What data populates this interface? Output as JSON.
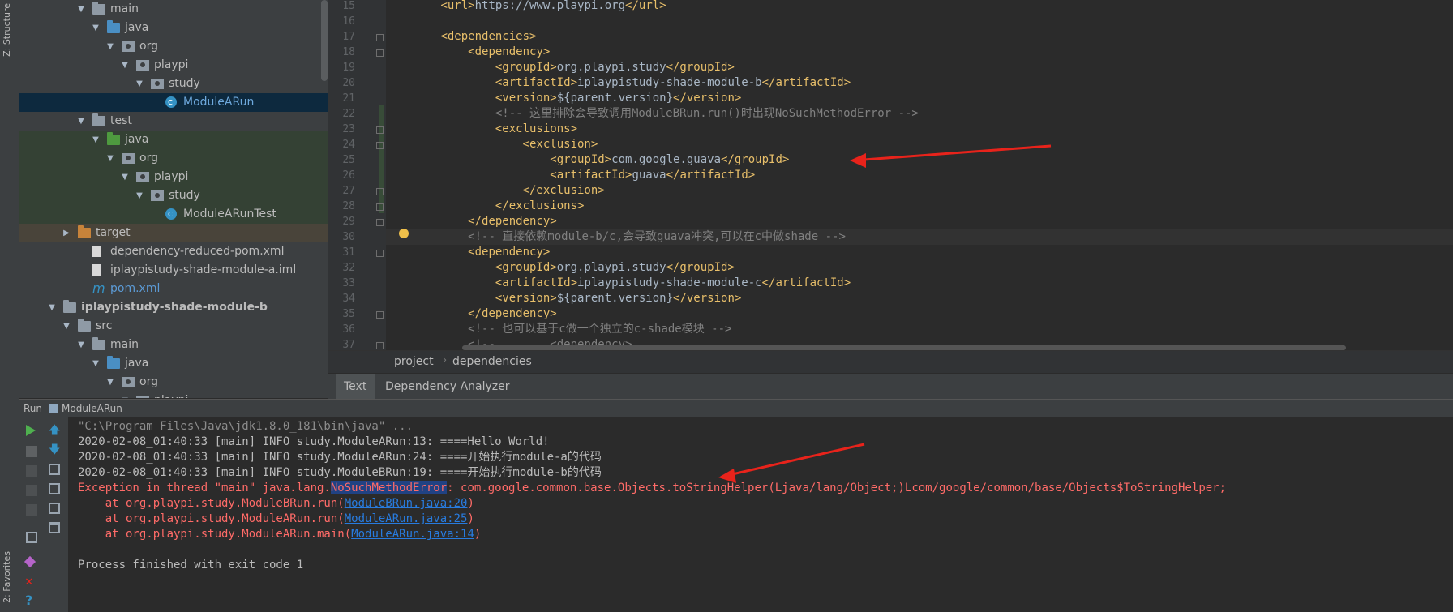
{
  "side_strip": {
    "top_label": "Z: Structure",
    "bottom_label": "2: Favorites"
  },
  "tree": [
    {
      "label": "main",
      "type": "folder",
      "depth": 3,
      "open": true
    },
    {
      "label": "java",
      "type": "folder-src",
      "depth": 4,
      "open": true
    },
    {
      "label": "org",
      "type": "pkg",
      "depth": 5,
      "open": true
    },
    {
      "label": "playpi",
      "type": "pkg",
      "depth": 6,
      "open": true
    },
    {
      "label": "study",
      "type": "pkg",
      "depth": 7,
      "open": true
    },
    {
      "label": "ModuleARun",
      "type": "class",
      "depth": 8,
      "open": null,
      "selected": true
    },
    {
      "label": "test",
      "type": "folder",
      "depth": 3,
      "open": true
    },
    {
      "label": "java",
      "type": "folder-test",
      "depth": 4,
      "open": true,
      "testbg": true
    },
    {
      "label": "org",
      "type": "pkg",
      "depth": 5,
      "open": true,
      "testbg": true
    },
    {
      "label": "playpi",
      "type": "pkg",
      "depth": 6,
      "open": true,
      "testbg": true
    },
    {
      "label": "study",
      "type": "pkg",
      "depth": 7,
      "open": true,
      "testbg": true
    },
    {
      "label": "ModuleARunTest",
      "type": "class",
      "depth": 8,
      "open": null,
      "testbg": true
    },
    {
      "label": "target",
      "type": "folder-orange",
      "depth": 2,
      "open": false,
      "targetbg": true
    },
    {
      "label": "dependency-reduced-pom.xml",
      "type": "file",
      "depth": 3,
      "open": null
    },
    {
      "label": "iplaypistudy-shade-module-a.iml",
      "type": "file",
      "depth": 3,
      "open": null
    },
    {
      "label": "pom.xml",
      "type": "maven",
      "depth": 3,
      "open": null,
      "blue": true
    },
    {
      "label": "iplaypistudy-shade-module-b",
      "type": "folder",
      "depth": 1,
      "open": true,
      "bold": true
    },
    {
      "label": "src",
      "type": "folder",
      "depth": 2,
      "open": true
    },
    {
      "label": "main",
      "type": "folder",
      "depth": 3,
      "open": true
    },
    {
      "label": "java",
      "type": "folder-src",
      "depth": 4,
      "open": true
    },
    {
      "label": "org",
      "type": "pkg",
      "depth": 5,
      "open": true
    },
    {
      "label": "playpi",
      "type": "pkg",
      "depth": 6,
      "open": true
    }
  ],
  "gutter_lines": [
    "15",
    "16",
    "17",
    "18",
    "19",
    "20",
    "21",
    "22",
    "23",
    "24",
    "25",
    "26",
    "27",
    "28",
    "29",
    "30",
    "31",
    "32",
    "33",
    "34",
    "35",
    "36",
    "37"
  ],
  "code_lines": [
    [
      {
        "c": "txt",
        "t": "        "
      },
      {
        "c": "tag",
        "t": "<url>"
      },
      {
        "c": "txt",
        "t": "https://www.playpi.org"
      },
      {
        "c": "tag",
        "t": "</url>"
      }
    ],
    [],
    [
      {
        "c": "txt",
        "t": "        "
      },
      {
        "c": "tag",
        "t": "<dependencies>"
      }
    ],
    [
      {
        "c": "txt",
        "t": "            "
      },
      {
        "c": "tag",
        "t": "<dependency>"
      }
    ],
    [
      {
        "c": "txt",
        "t": "                "
      },
      {
        "c": "tag",
        "t": "<groupId>"
      },
      {
        "c": "txt",
        "t": "org.playpi.study"
      },
      {
        "c": "tag",
        "t": "</groupId>"
      }
    ],
    [
      {
        "c": "txt",
        "t": "                "
      },
      {
        "c": "tag",
        "t": "<artifactId>"
      },
      {
        "c": "txt",
        "t": "iplaypistudy-shade-module-b"
      },
      {
        "c": "tag",
        "t": "</artifactId>"
      }
    ],
    [
      {
        "c": "txt",
        "t": "                "
      },
      {
        "c": "tag",
        "t": "<version>"
      },
      {
        "c": "txt",
        "t": "${parent.version}"
      },
      {
        "c": "tag",
        "t": "</version>"
      }
    ],
    [
      {
        "c": "txt",
        "t": "                "
      },
      {
        "c": "cmt",
        "t": "<!-- 这里排除会导致调用ModuleBRun.run()时出现NoSuchMethodError -->"
      }
    ],
    [
      {
        "c": "txt",
        "t": "                "
      },
      {
        "c": "tag",
        "t": "<exclusions>"
      }
    ],
    [
      {
        "c": "txt",
        "t": "                    "
      },
      {
        "c": "tag",
        "t": "<exclusion>"
      }
    ],
    [
      {
        "c": "txt",
        "t": "                        "
      },
      {
        "c": "tag",
        "t": "<groupId>"
      },
      {
        "c": "txt",
        "t": "com.google.guava"
      },
      {
        "c": "tag",
        "t": "</groupId>"
      }
    ],
    [
      {
        "c": "txt",
        "t": "                        "
      },
      {
        "c": "tag",
        "t": "<artifactId>"
      },
      {
        "c": "txt",
        "t": "guava"
      },
      {
        "c": "tag",
        "t": "</artifactId>"
      }
    ],
    [
      {
        "c": "txt",
        "t": "                    "
      },
      {
        "c": "tag",
        "t": "</exclusion>"
      }
    ],
    [
      {
        "c": "txt",
        "t": "                "
      },
      {
        "c": "tag",
        "t": "</exclusions>"
      }
    ],
    [
      {
        "c": "txt",
        "t": "            "
      },
      {
        "c": "tag",
        "t": "</dependency>"
      }
    ],
    [
      {
        "c": "txt",
        "t": "            "
      },
      {
        "c": "cmt",
        "t": "<!-- 直接依赖module-b/c,会导致guava冲突,可以在c中做shade -->"
      }
    ],
    [
      {
        "c": "txt",
        "t": "            "
      },
      {
        "c": "tag",
        "t": "<dependency>"
      }
    ],
    [
      {
        "c": "txt",
        "t": "                "
      },
      {
        "c": "tag",
        "t": "<groupId>"
      },
      {
        "c": "txt",
        "t": "org.playpi.study"
      },
      {
        "c": "tag",
        "t": "</groupId>"
      }
    ],
    [
      {
        "c": "txt",
        "t": "                "
      },
      {
        "c": "tag",
        "t": "<artifactId>"
      },
      {
        "c": "txt",
        "t": "iplaypistudy-shade-module-c"
      },
      {
        "c": "tag",
        "t": "</artifactId>"
      }
    ],
    [
      {
        "c": "txt",
        "t": "                "
      },
      {
        "c": "tag",
        "t": "<version>"
      },
      {
        "c": "txt",
        "t": "${parent.version}"
      },
      {
        "c": "tag",
        "t": "</version>"
      }
    ],
    [
      {
        "c": "txt",
        "t": "            "
      },
      {
        "c": "tag",
        "t": "</dependency>"
      }
    ],
    [
      {
        "c": "txt",
        "t": "            "
      },
      {
        "c": "cmt",
        "t": "<!-- 也可以基于c做一个独立的c-shade模块 -->"
      }
    ],
    [
      {
        "c": "txt",
        "t": "            "
      },
      {
        "c": "cmt",
        "t": "<!--        <dependency>"
      }
    ]
  ],
  "breadcrumb": [
    "project",
    "dependencies"
  ],
  "tabs": [
    "Text",
    "Dependency Analyzer"
  ],
  "run_header": {
    "label": "Run",
    "config": "ModuleARun"
  },
  "console": {
    "cmd": "\"C:\\Program Files\\Java\\jdk1.8.0_181\\bin\\java\" ...",
    "info": [
      "2020-02-08_01:40:33 [main] INFO study.ModuleARun:13: ====Hello World!",
      "2020-02-08_01:40:33 [main] INFO study.ModuleARun:24: ====开始执行module-a的代码",
      "2020-02-08_01:40:33 [main] INFO study.ModuleBRun:19: ====开始执行module-b的代码"
    ],
    "exc_prefix": "Exception in thread \"main\" java.lang.",
    "exc_name": "NoSuchMethodError",
    "exc_suffix": ": com.google.common.base.Objects.toStringHelper(Ljava/lang/Object;)Lcom/google/common/base/Objects$ToStringHelper;",
    "stack": [
      {
        "prefix": "    at org.playpi.study.ModuleBRun.run(",
        "link": "ModuleBRun.java:20",
        "suffix": ")"
      },
      {
        "prefix": "    at org.playpi.study.ModuleARun.run(",
        "link": "ModuleARun.java:25",
        "suffix": ")"
      },
      {
        "prefix": "    at org.playpi.study.ModuleARun.main(",
        "link": "ModuleARun.java:14",
        "suffix": ")"
      }
    ],
    "exit": "Process finished with exit code 1"
  },
  "colors": {
    "annotation": "#e8231b",
    "error": "#ff6b68",
    "link": "#287bde"
  }
}
